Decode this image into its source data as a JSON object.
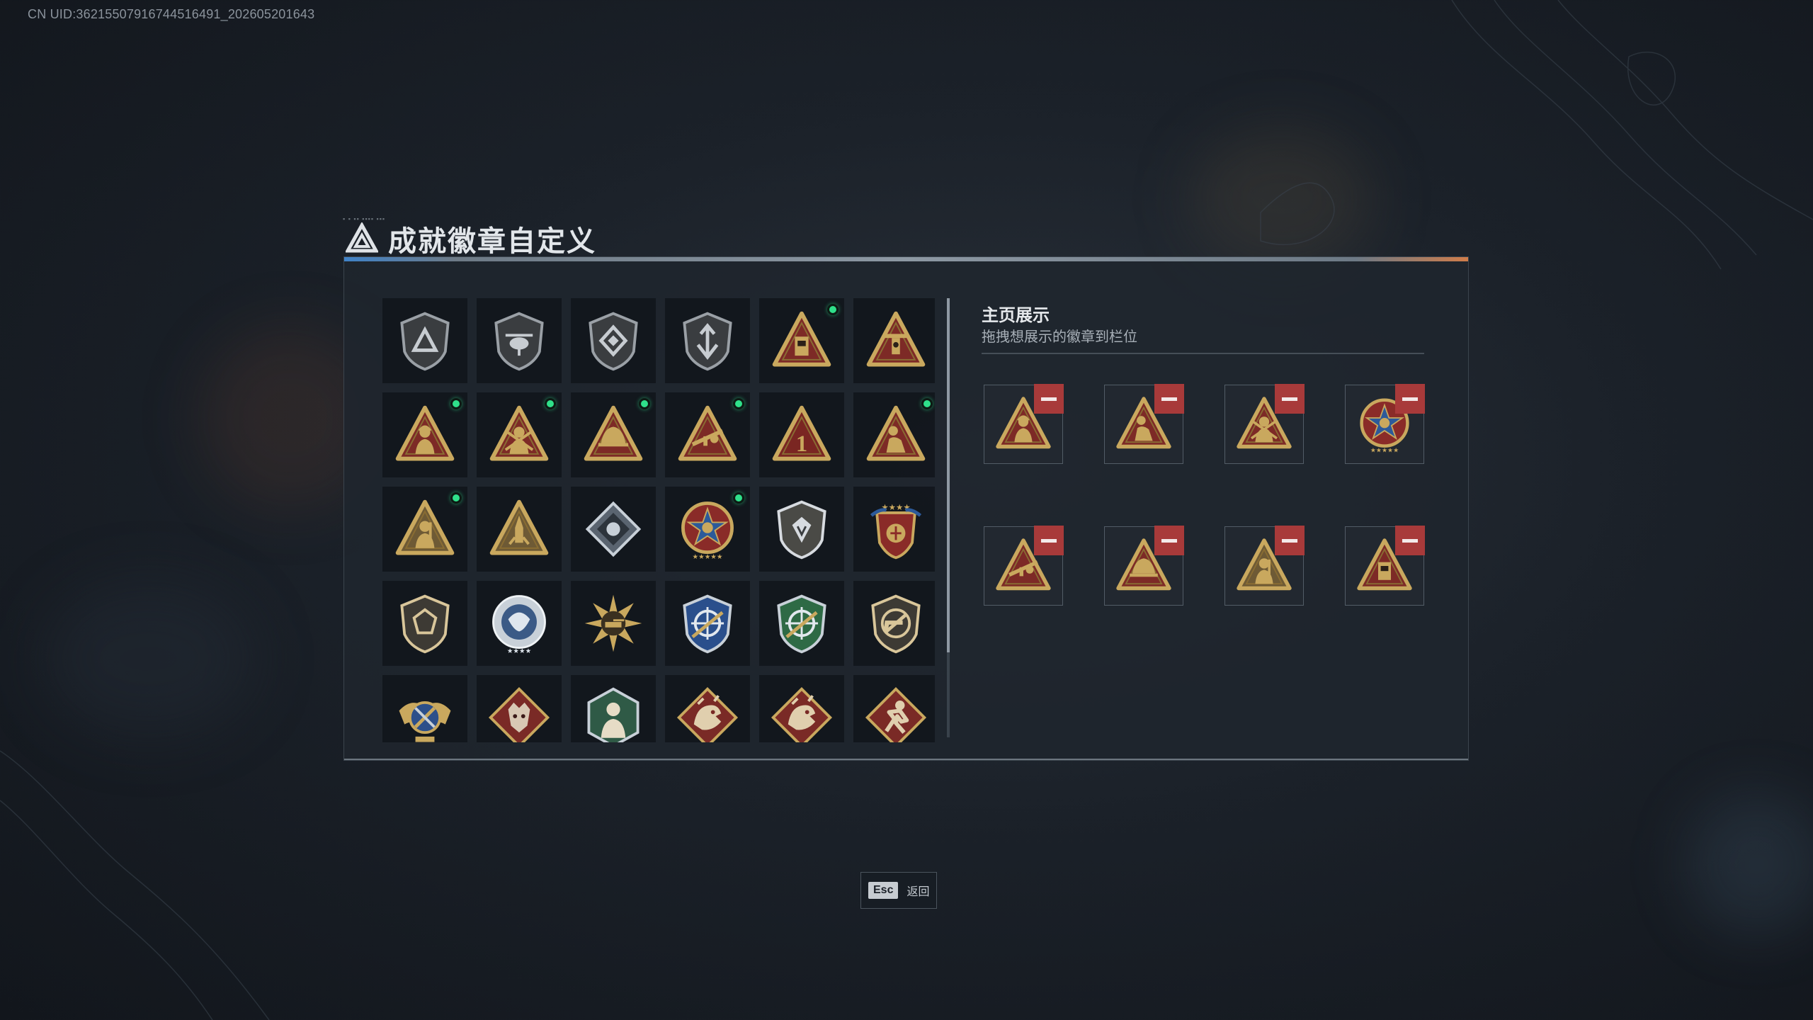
{
  "uid_text": "CN UID:3621550791674451649​1_202605201643",
  "title": "成就徽章自定义",
  "showcase": {
    "title": "主页展示",
    "subtitle": "拖拽想展示的徽章到栏位"
  },
  "footer": {
    "key": "Esc",
    "label": "返回"
  },
  "colors": {
    "accent_green": "#2fe08a",
    "remove_red": "#a83a3a",
    "gold": "#c9a85e"
  },
  "grid_badges": [
    {
      "icon": "shield-triangle-badge-icon",
      "new": false
    },
    {
      "icon": "shield-helicopter-badge-icon",
      "new": false
    },
    {
      "icon": "shield-diamond-badge-icon",
      "new": false
    },
    {
      "icon": "shield-arrow-badge-icon",
      "new": false
    },
    {
      "icon": "triangle-radio-badge-icon",
      "new": true
    },
    {
      "icon": "triangle-tower-badge-icon",
      "new": false
    },
    {
      "icon": "triangle-hooded-badge-icon",
      "new": true
    },
    {
      "icon": "triangle-soldier-badge-icon",
      "new": true
    },
    {
      "icon": "triangle-helmet-badge-icon",
      "new": true
    },
    {
      "icon": "triangle-rifle-badge-icon",
      "new": true
    },
    {
      "icon": "triangle-number-one-badge-icon",
      "new": false
    },
    {
      "icon": "triangle-kneeling-badge-icon",
      "new": true
    },
    {
      "icon": "triangle-trooper-badge-icon",
      "new": true
    },
    {
      "icon": "triangle-rocket-badge-icon",
      "new": false
    },
    {
      "icon": "diamond-silver-badge-icon",
      "new": false
    },
    {
      "icon": "star-medal-badge-icon",
      "new": true
    },
    {
      "icon": "shield-emblem-badge-icon",
      "new": false
    },
    {
      "icon": "shield-stars-badge-icon",
      "new": false
    },
    {
      "icon": "shield-plain-badge-icon",
      "new": false
    },
    {
      "icon": "round-silver-badge-icon",
      "new": false
    },
    {
      "icon": "sunburst-tank-badge-icon",
      "new": false
    },
    {
      "icon": "blue-crosshair-badge-icon",
      "new": false
    },
    {
      "icon": "green-crosshair-badge-icon",
      "new": false
    },
    {
      "icon": "shield-no-gun-badge-icon",
      "new": false
    },
    {
      "icon": "gold-wings-badge-icon",
      "new": false
    },
    {
      "icon": "red-wolf-badge-icon",
      "new": false
    },
    {
      "icon": "hex-soldier-badge-icon",
      "new": false
    },
    {
      "icon": "red-dragon-badge-icon",
      "new": false
    },
    {
      "icon": "red-dragon-badge-icon",
      "new": false
    },
    {
      "icon": "red-runner-badge-icon",
      "new": false
    }
  ],
  "showcase_slots": [
    {
      "icon": "triangle-hooded-badge-icon"
    },
    {
      "icon": "triangle-kneeling-badge-icon"
    },
    {
      "icon": "triangle-soldier-badge-icon"
    },
    {
      "icon": "star-medal-badge-icon"
    },
    {
      "icon": "triangle-rifle-badge-icon"
    },
    {
      "icon": "triangle-helmet-badge-icon"
    },
    {
      "icon": "triangle-trooper-badge-icon"
    },
    {
      "icon": "triangle-radio-badge-icon"
    }
  ]
}
